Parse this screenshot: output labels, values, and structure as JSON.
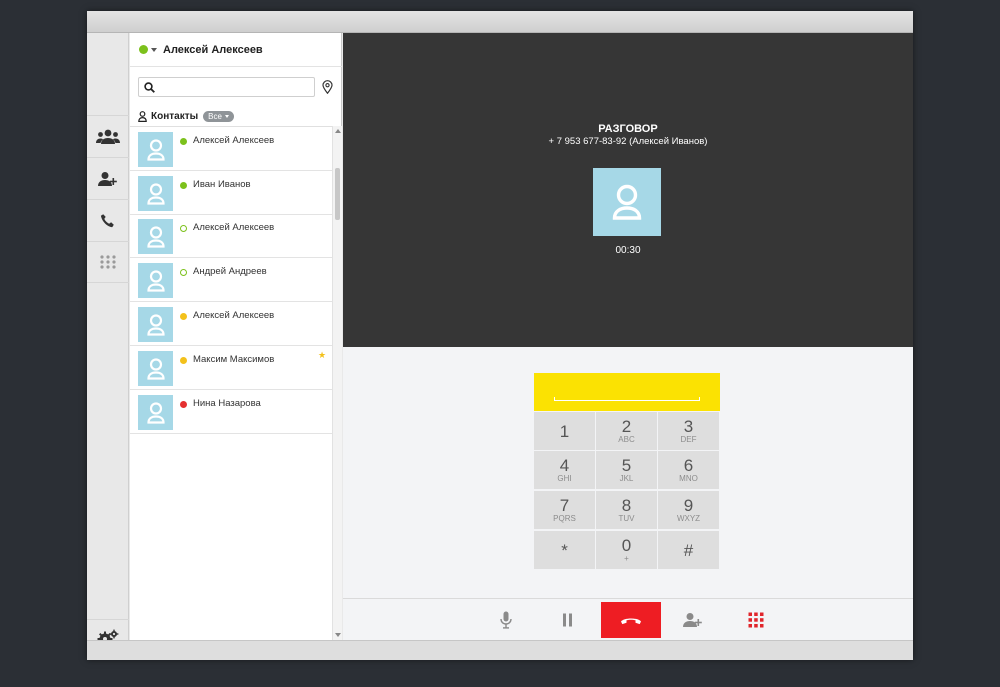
{
  "user": {
    "name": "Алексей Алексеев",
    "status_color": "#7cc11c"
  },
  "search": {
    "placeholder": "",
    "value": ""
  },
  "filter": {
    "label": "Контакты",
    "selected": "Все"
  },
  "contacts": [
    {
      "name": "Алексей Алексеев",
      "presence": "online",
      "color": "#7cc11c",
      "favorite": false
    },
    {
      "name": "Иван Иванов",
      "presence": "online",
      "color": "#7cc11c",
      "favorite": false
    },
    {
      "name": "Алексей Алексеев",
      "presence": "online-ring",
      "color": "#7cc11c",
      "favorite": false
    },
    {
      "name": "Андрей Андреев",
      "presence": "online-ring",
      "color": "#7cc11c",
      "favorite": false
    },
    {
      "name": "Алексей Алексеев",
      "presence": "away",
      "color": "#f3c11b",
      "favorite": false
    },
    {
      "name": "Максим Максимов",
      "presence": "away",
      "color": "#f3c11b",
      "favorite": true
    },
    {
      "name": "Нина Назарова",
      "presence": "busy",
      "color": "#e53030",
      "favorite": false
    }
  ],
  "call": {
    "title": "РАЗГОВОР",
    "number": "+ 7 953 677-83-92 (Алексей Иванов)",
    "timer": "00:30"
  },
  "dialpad": {
    "input_value": "",
    "accent": "#fbe202",
    "keys": [
      {
        "digit": "1",
        "letters": ""
      },
      {
        "digit": "2",
        "letters": "ABC"
      },
      {
        "digit": "3",
        "letters": "DEF"
      },
      {
        "digit": "4",
        "letters": "GHI"
      },
      {
        "digit": "5",
        "letters": "JKL"
      },
      {
        "digit": "6",
        "letters": "MNO"
      },
      {
        "digit": "7",
        "letters": "PQRS"
      },
      {
        "digit": "8",
        "letters": "TUV"
      },
      {
        "digit": "9",
        "letters": "WXYZ"
      },
      {
        "digit": "*",
        "letters": ""
      },
      {
        "digit": "0",
        "letters": "+"
      },
      {
        "digit": "#",
        "letters": ""
      }
    ]
  },
  "toolbar": {
    "icons": [
      "microphone-icon",
      "pause-icon",
      "hang-up-icon",
      "add-participant-icon",
      "dialpad-icon"
    ],
    "hangup_color": "#ee1d23"
  },
  "rail": {
    "icons": [
      "contacts-group-icon",
      "add-contact-icon",
      "phone-icon",
      "dialpad-icon",
      "settings-icon"
    ]
  }
}
